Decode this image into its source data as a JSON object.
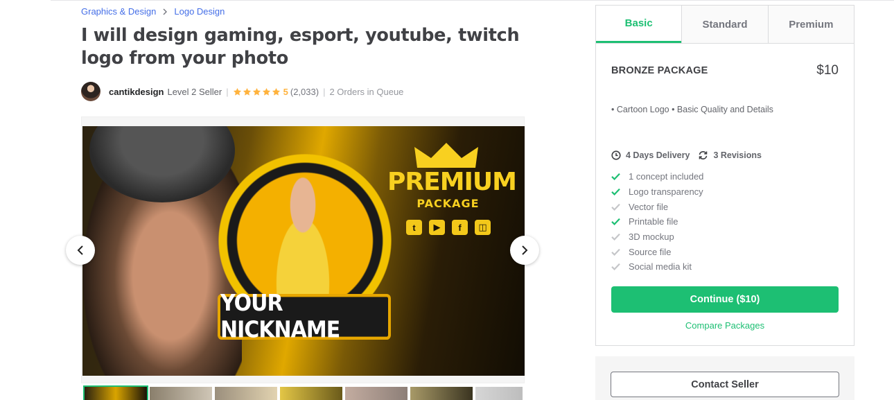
{
  "breadcrumb": {
    "items": [
      "Graphics & Design",
      "Logo Design"
    ]
  },
  "gig": {
    "title": "I will design gaming, esport, youtube, twitch logo from your photo"
  },
  "seller": {
    "name": "cantikdesign",
    "level": "Level 2 Seller",
    "rating": "5",
    "reviews": "(2,033)",
    "queue": "2 Orders in Queue",
    "star_count": 5,
    "star_color": "#ffb33e"
  },
  "gallery": {
    "hero_text": {
      "premium": "PREMIUM",
      "package": "PACKAGE",
      "nickname": "YOUR NICKNAME"
    },
    "social_icons": [
      "twitter-icon",
      "youtube-icon",
      "facebook-icon",
      "twitch-icon"
    ],
    "thumbnail_count": 7
  },
  "package": {
    "tabs": [
      "Basic",
      "Standard",
      "Premium"
    ],
    "active_tab": "Basic",
    "name": "BRONZE PACKAGE",
    "price": "$10",
    "description": "• Cartoon Logo • Basic Quality and Details",
    "delivery": "4 Days Delivery",
    "revisions": "3 Revisions",
    "features": [
      {
        "label": "1 concept included",
        "included": true
      },
      {
        "label": "Logo transparency",
        "included": true
      },
      {
        "label": "Vector file",
        "included": false
      },
      {
        "label": "Printable file",
        "included": true
      },
      {
        "label": "3D mockup",
        "included": false
      },
      {
        "label": "Source file",
        "included": false
      },
      {
        "label": "Social media kit",
        "included": false
      }
    ],
    "continue_label": "Continue ($10)",
    "compare_label": "Compare Packages"
  },
  "contact": {
    "label": "Contact Seller"
  },
  "colors": {
    "accent": "#1dbf73",
    "link": "#446ee7",
    "text": "#404145"
  }
}
